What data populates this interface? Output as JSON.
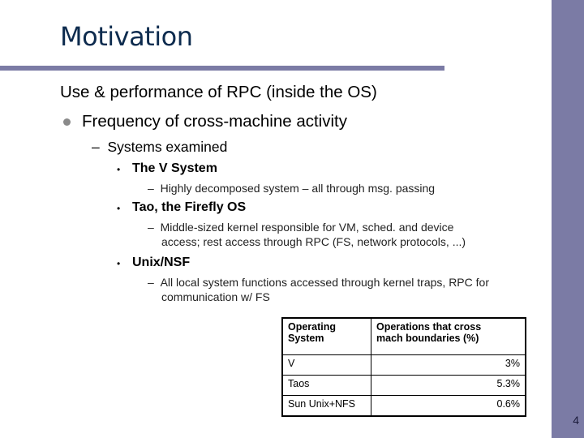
{
  "slide": {
    "title": "Motivation",
    "page_number": "4",
    "main_point": "Use & performance of RPC (inside the OS)",
    "sub_point": "Frequency of cross-machine activity",
    "sub_sub_point": "Systems examined",
    "systems": [
      {
        "name": "The V System",
        "details": [
          "Highly decomposed system – all through msg. passing"
        ]
      },
      {
        "name": "Tao, the Firefly OS",
        "details": [
          "Middle-sized kernel responsible for VM, sched.  and device",
          "access; rest access through RPC (FS, network protocols, ...)"
        ]
      },
      {
        "name": "Unix/NSF",
        "details": [
          "All local system functions accessed through kernel traps, RPC for",
          "communication w/ FS"
        ]
      }
    ],
    "table": {
      "headers": [
        [
          "Operating",
          "System"
        ],
        [
          "Operations that cross",
          "mach boundaries (%)"
        ]
      ],
      "rows": [
        {
          "os": "V",
          "value": "3%"
        },
        {
          "os": "Taos",
          "value": "5.3%"
        },
        {
          "os": "Sun Unix+NFS",
          "value": "0.6%"
        }
      ]
    }
  },
  "colors": {
    "accent": "#7b7ba5",
    "title": "#0d2b4e"
  }
}
